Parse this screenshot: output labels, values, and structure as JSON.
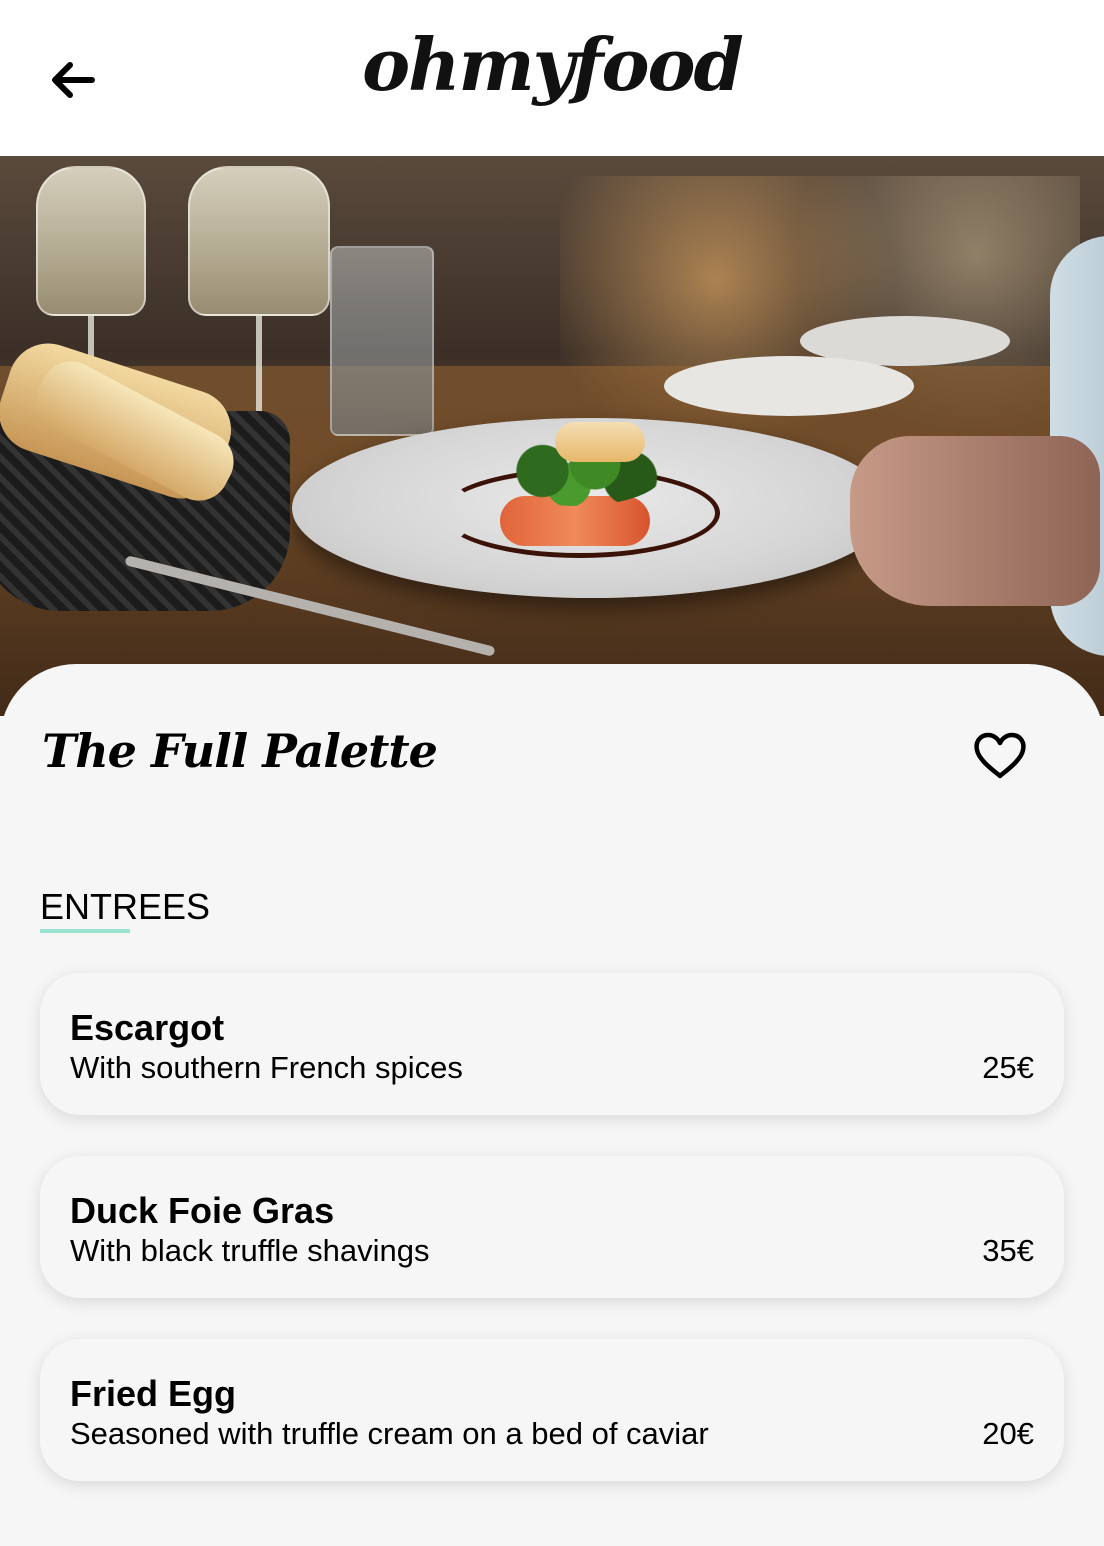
{
  "header": {
    "logo": "ohmyfood",
    "back_icon": "arrow-left-icon"
  },
  "hero": {
    "image_subject": "plated-dish-photo"
  },
  "restaurant": {
    "name": "The Full Palette",
    "like_icon": "heart-outline-icon"
  },
  "menu": {
    "section_title": "ENTREES",
    "accent_color": "#99e2d0",
    "items": [
      {
        "name": "Escargot",
        "description": "With southern French spices",
        "price": "25€"
      },
      {
        "name": "Duck Foie Gras",
        "description": "With black truffle shavings",
        "price": "35€"
      },
      {
        "name": "Fried Egg",
        "description": "Seasoned with truffle cream on a bed of caviar",
        "price": "20€"
      }
    ]
  }
}
